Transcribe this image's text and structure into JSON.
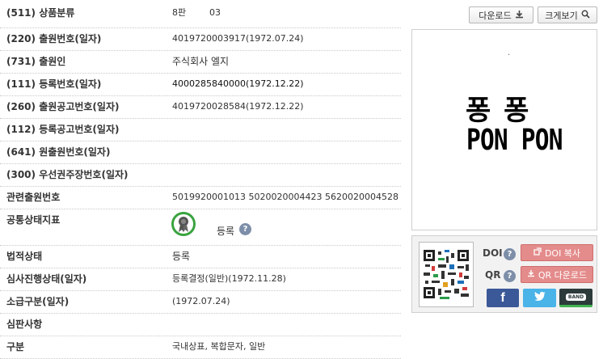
{
  "fields": [
    {
      "label": "(511) 상품분류",
      "value": "8판",
      "value2": "03"
    },
    {
      "label": "(220) 출원번호(일자)",
      "value": "4019720003917(1972.07.24)"
    },
    {
      "label": "(731) 출원인",
      "value": "주식회사 엘지"
    },
    {
      "label": "(111) 등록번호(일자)",
      "value": "4000285840000(1972.12.22)"
    },
    {
      "label": "(260) 출원공고번호(일자)",
      "value": "4019720028584(1972.12.22)"
    },
    {
      "label": "(112) 등록공고번호(일자)",
      "value": ""
    },
    {
      "label": "(641) 원출원번호(일자)",
      "value": ""
    },
    {
      "label": "(300) 우선권주장번호(일자)",
      "value": ""
    },
    {
      "label": "관련출원번호",
      "value": "5019920001013 5020020004423 5620020004528"
    },
    {
      "label": "공통상태지표",
      "value": "등록"
    },
    {
      "label": "법적상태",
      "value": "등록"
    },
    {
      "label": "심사진행상태(일자)",
      "value": "등록결정(일반)(1972.11.28)"
    },
    {
      "label": "소급구분(일자)",
      "value": "(1972.07.24)"
    },
    {
      "label": "심판사항",
      "value": ""
    },
    {
      "label": "구분",
      "value": "국내상표, 복합문자, 일반"
    }
  ],
  "toolbar": {
    "download_label": "다운로드",
    "zoom_label": "크게보기"
  },
  "mark_image": {
    "line1": "퐁 퐁",
    "line2": "PON PON"
  },
  "share": {
    "doi_label": "DOI",
    "qr_label": "QR",
    "doi_copy_label": "DOI 복사",
    "qr_download_label": "QR 다운로드",
    "band_label": "BAND",
    "help_glyph": "?"
  },
  "colors": {
    "status_green": "#3aa340",
    "pink_button": "#e48b8b",
    "facebook": "#3b5998",
    "twitter": "#4ab3e8",
    "band": "#2c3a3a"
  },
  "icons": [
    "download-icon",
    "search-icon",
    "registered-status-icon",
    "help-icon",
    "qr-code-icon",
    "link-icon",
    "facebook-icon",
    "twitter-icon",
    "band-icon"
  ]
}
